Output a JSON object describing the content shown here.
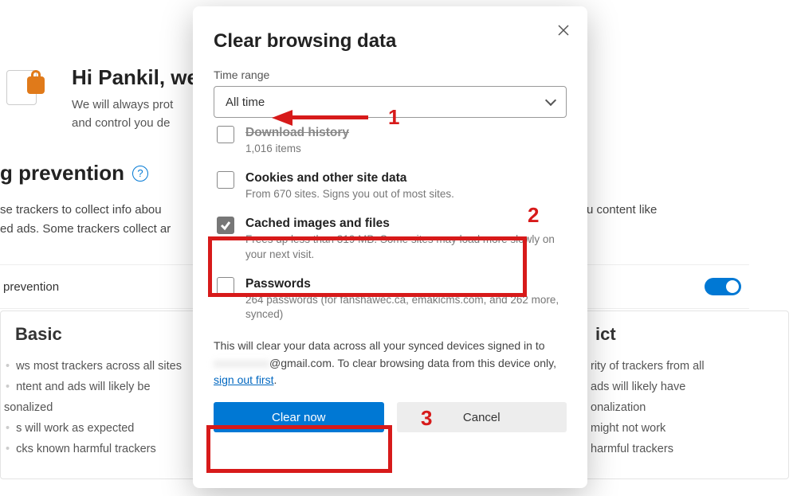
{
  "bg": {
    "greeting_title": "Hi Pankil, we",
    "greeting_line1": "We will always prot",
    "greeting_line2": "and control you de",
    "section_title": "g prevention",
    "section_desc_1": "se trackers to collect info abou",
    "section_desc_1b": "show you content like",
    "section_desc_2": "ed ads. Some trackers collect ar",
    "prev_row_label": "prevention",
    "basic": {
      "title": "Basic",
      "b1": "ws most trackers across all sites",
      "b2": "ntent and ads will likely be",
      "b2b": "sonalized",
      "b3": "s will work as expected",
      "b4": "cks known harmful trackers"
    },
    "strict": {
      "title": "ict",
      "s1": "rity of trackers from all",
      "s2": "ads will likely have",
      "s2b": "onalization",
      "s3": "might not work",
      "s4": "harmful trackers"
    }
  },
  "modal": {
    "title": "Clear browsing data",
    "time_range_label": "Time range",
    "time_range_value": "All time",
    "options": {
      "download": {
        "title": "Download history",
        "sub": "1,016 items"
      },
      "cookies": {
        "title": "Cookies and other site data",
        "sub": "From 670 sites. Signs you out of most sites."
      },
      "cache": {
        "title": "Cached images and files",
        "sub": "Frees up less than 319 MB. Some sites may load more slowly on your next visit."
      },
      "passwords": {
        "title": "Passwords",
        "sub": "264 passwords (for fanshawec.ca, emakicms.com, and 262 more, synced)"
      }
    },
    "note_1": "This will clear your data across all your synced devices signed in to ",
    "note_email_masked": "xxxxxxxxxx",
    "note_2": "@gmail.com. To clear browsing data from this device only, ",
    "note_link": "sign out first",
    "btn_clear": "Clear now",
    "btn_cancel": "Cancel"
  },
  "ann": {
    "n1": "1",
    "n2": "2",
    "n3": "3"
  }
}
